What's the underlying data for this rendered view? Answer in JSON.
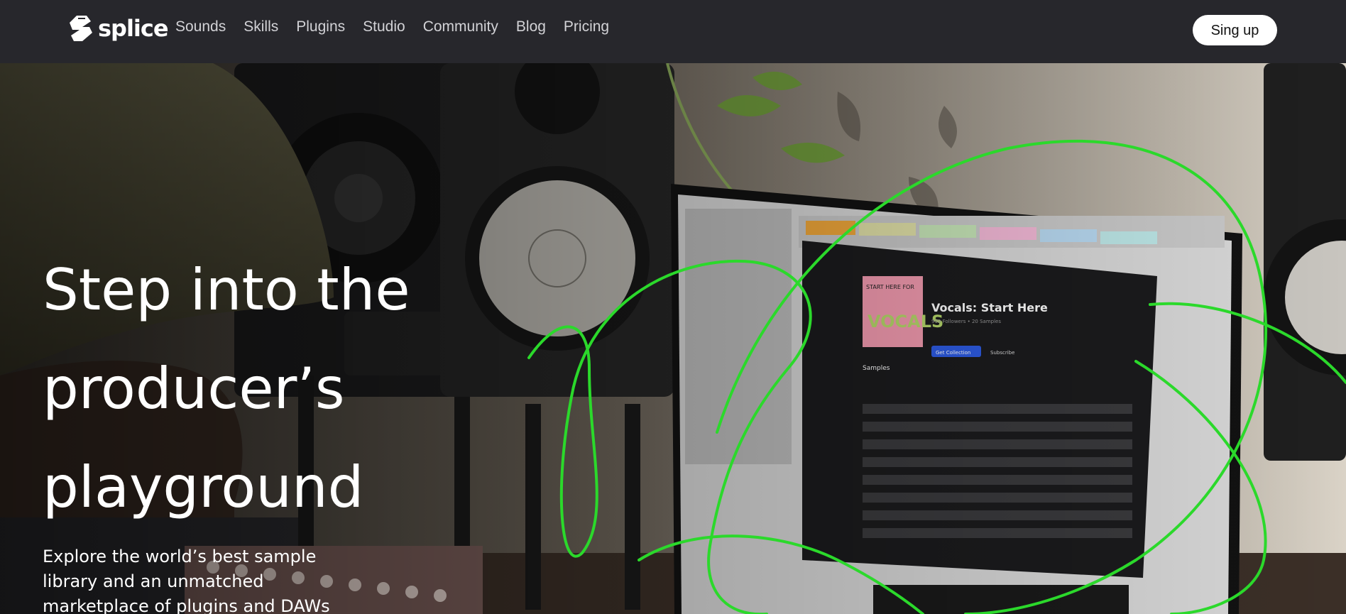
{
  "brand": {
    "name": "splice",
    "logo_icon": "splice-logo-icon",
    "accent": "#27272c"
  },
  "nav": {
    "items": [
      {
        "label": "Sounds"
      },
      {
        "label": "Skills"
      },
      {
        "label": "Plugins"
      },
      {
        "label": "Studio"
      },
      {
        "label": "Community"
      },
      {
        "label": "Blog"
      },
      {
        "label": "Pricing"
      }
    ]
  },
  "signup": {
    "label": "Sing up"
  },
  "hero": {
    "headline_lines": [
      "Step into the",
      "producer’s",
      "playground"
    ],
    "subtext": "Explore the world’s best sample library and an unmatched marketplace of plugins and DAWs"
  },
  "monitor_ui": {
    "collection_title": "Vocals: Start Here",
    "collection_meta": "999 Followers • 20 Samples",
    "cover_text": "START HERE FOR VOCALS",
    "button_label": "Get Collection",
    "subscribe_label": "Subscribe",
    "section_label": "Samples"
  },
  "colors": {
    "green_lines": "#2bd92b",
    "page_bg": "#26262b"
  }
}
